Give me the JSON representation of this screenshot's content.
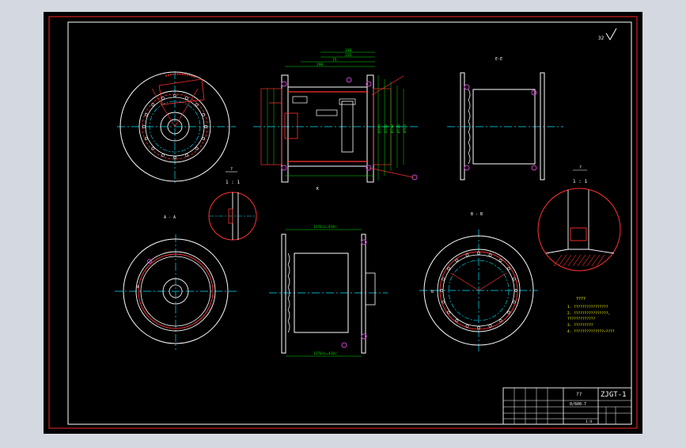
{
  "colors": {
    "background_outer": "#d4d8e0",
    "sheet": "#000000",
    "frame": "#cc2222",
    "line": "#ffffff",
    "center_line": "#00e5ff",
    "dimension": "#00dd00",
    "hidden": "#ff3030",
    "accent": "#cc44cc",
    "text_yellow": "#ffff00"
  },
  "sheet": {
    "roughness_symbol": "32"
  },
  "views": {
    "front_section_label": "K",
    "side_view_label": "E-E",
    "view_a_label": "A - A",
    "view_b_label": "B - B",
    "detail_left_id": "?",
    "detail_left_scale": "1 : 1",
    "detail_right_id": "?",
    "detail_right_scale": "1 : 1",
    "section_marker_a": "A",
    "section_marker_b": "B"
  },
  "dimensions": {
    "top_chain": [
      "330",
      "225",
      "75",
      "290"
    ],
    "right_chain": [
      "Ø780",
      "Ø760",
      "Ø740",
      "Ø720",
      "Ø700"
    ],
    "lower_barrel_top": "1170(L=410)",
    "lower_barrel_bottom": "1170(L=410)"
  },
  "notes": {
    "title": "????",
    "items": [
      "1. ????????????????",
      "2. ????????????????,",
      "   ?????????????",
      "3. ?????????",
      "4. ??????????????~????"
    ]
  },
  "title_block": {
    "name": "??",
    "drawing_no": "ZJGT-1",
    "code": "0/600-7",
    "scale": "1:4"
  }
}
